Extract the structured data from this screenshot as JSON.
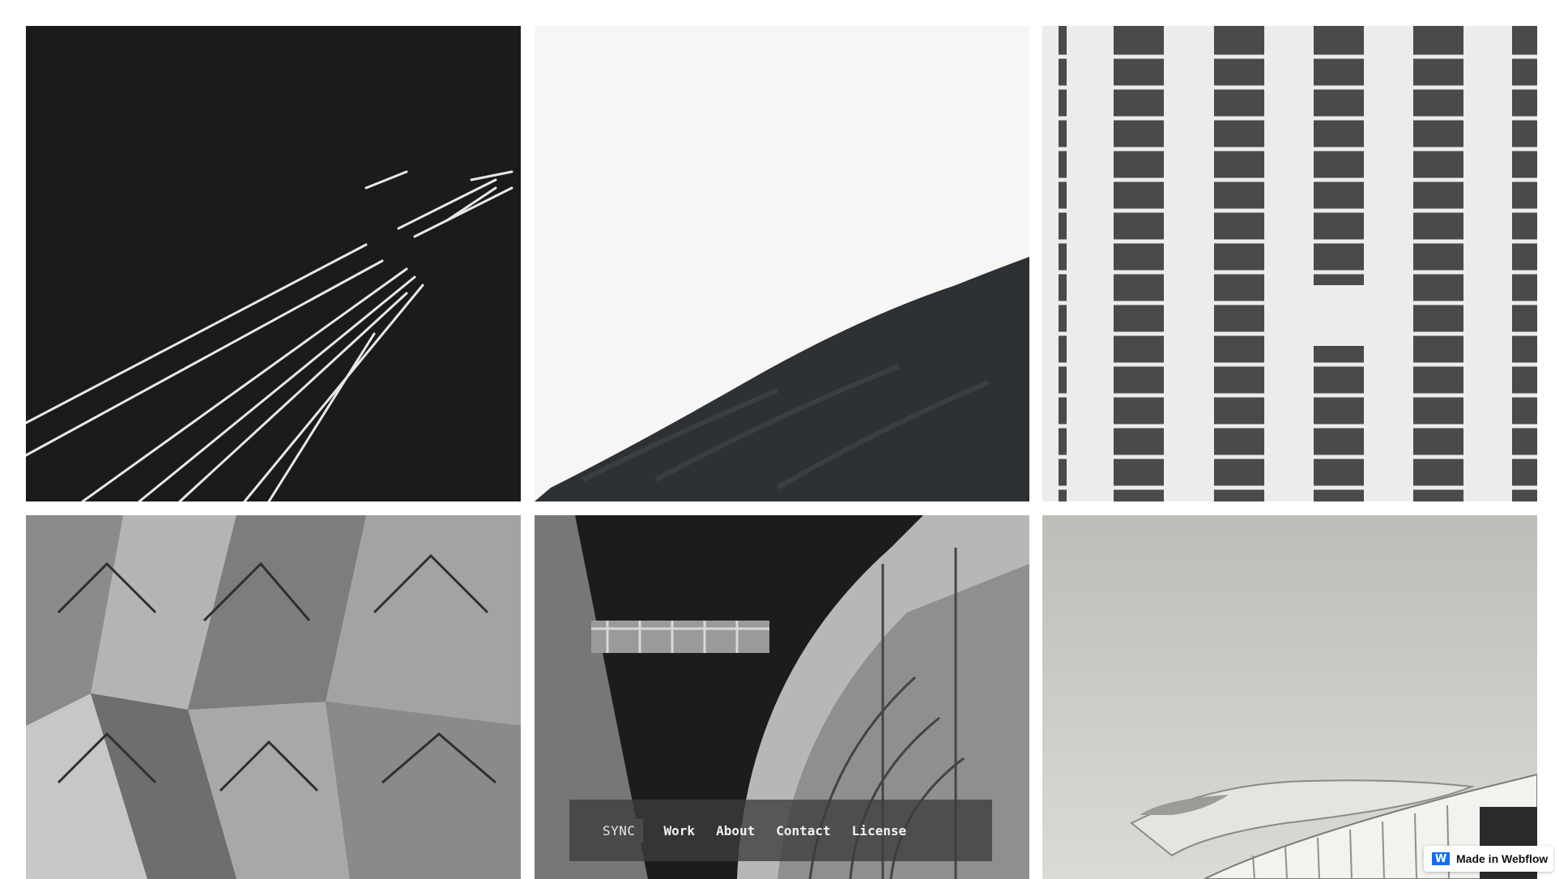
{
  "nav": {
    "logo": "SYNC",
    "links": [
      "Work",
      "About",
      "Contact",
      "License"
    ]
  },
  "badge": {
    "icon": "webflow-icon",
    "label": "Made in Webflow",
    "color": "#146ef5"
  },
  "gallery": {
    "tiles": [
      {
        "name": "light-trails-photo",
        "tone": "dark"
      },
      {
        "name": "sand-dune-photo",
        "tone": "light"
      },
      {
        "name": "building-windows-photo",
        "tone": "light"
      },
      {
        "name": "angular-facade-photo",
        "tone": "mid"
      },
      {
        "name": "curved-architecture-photo",
        "tone": "dark"
      },
      {
        "name": "spiral-ramp-photo",
        "tone": "light"
      }
    ]
  }
}
